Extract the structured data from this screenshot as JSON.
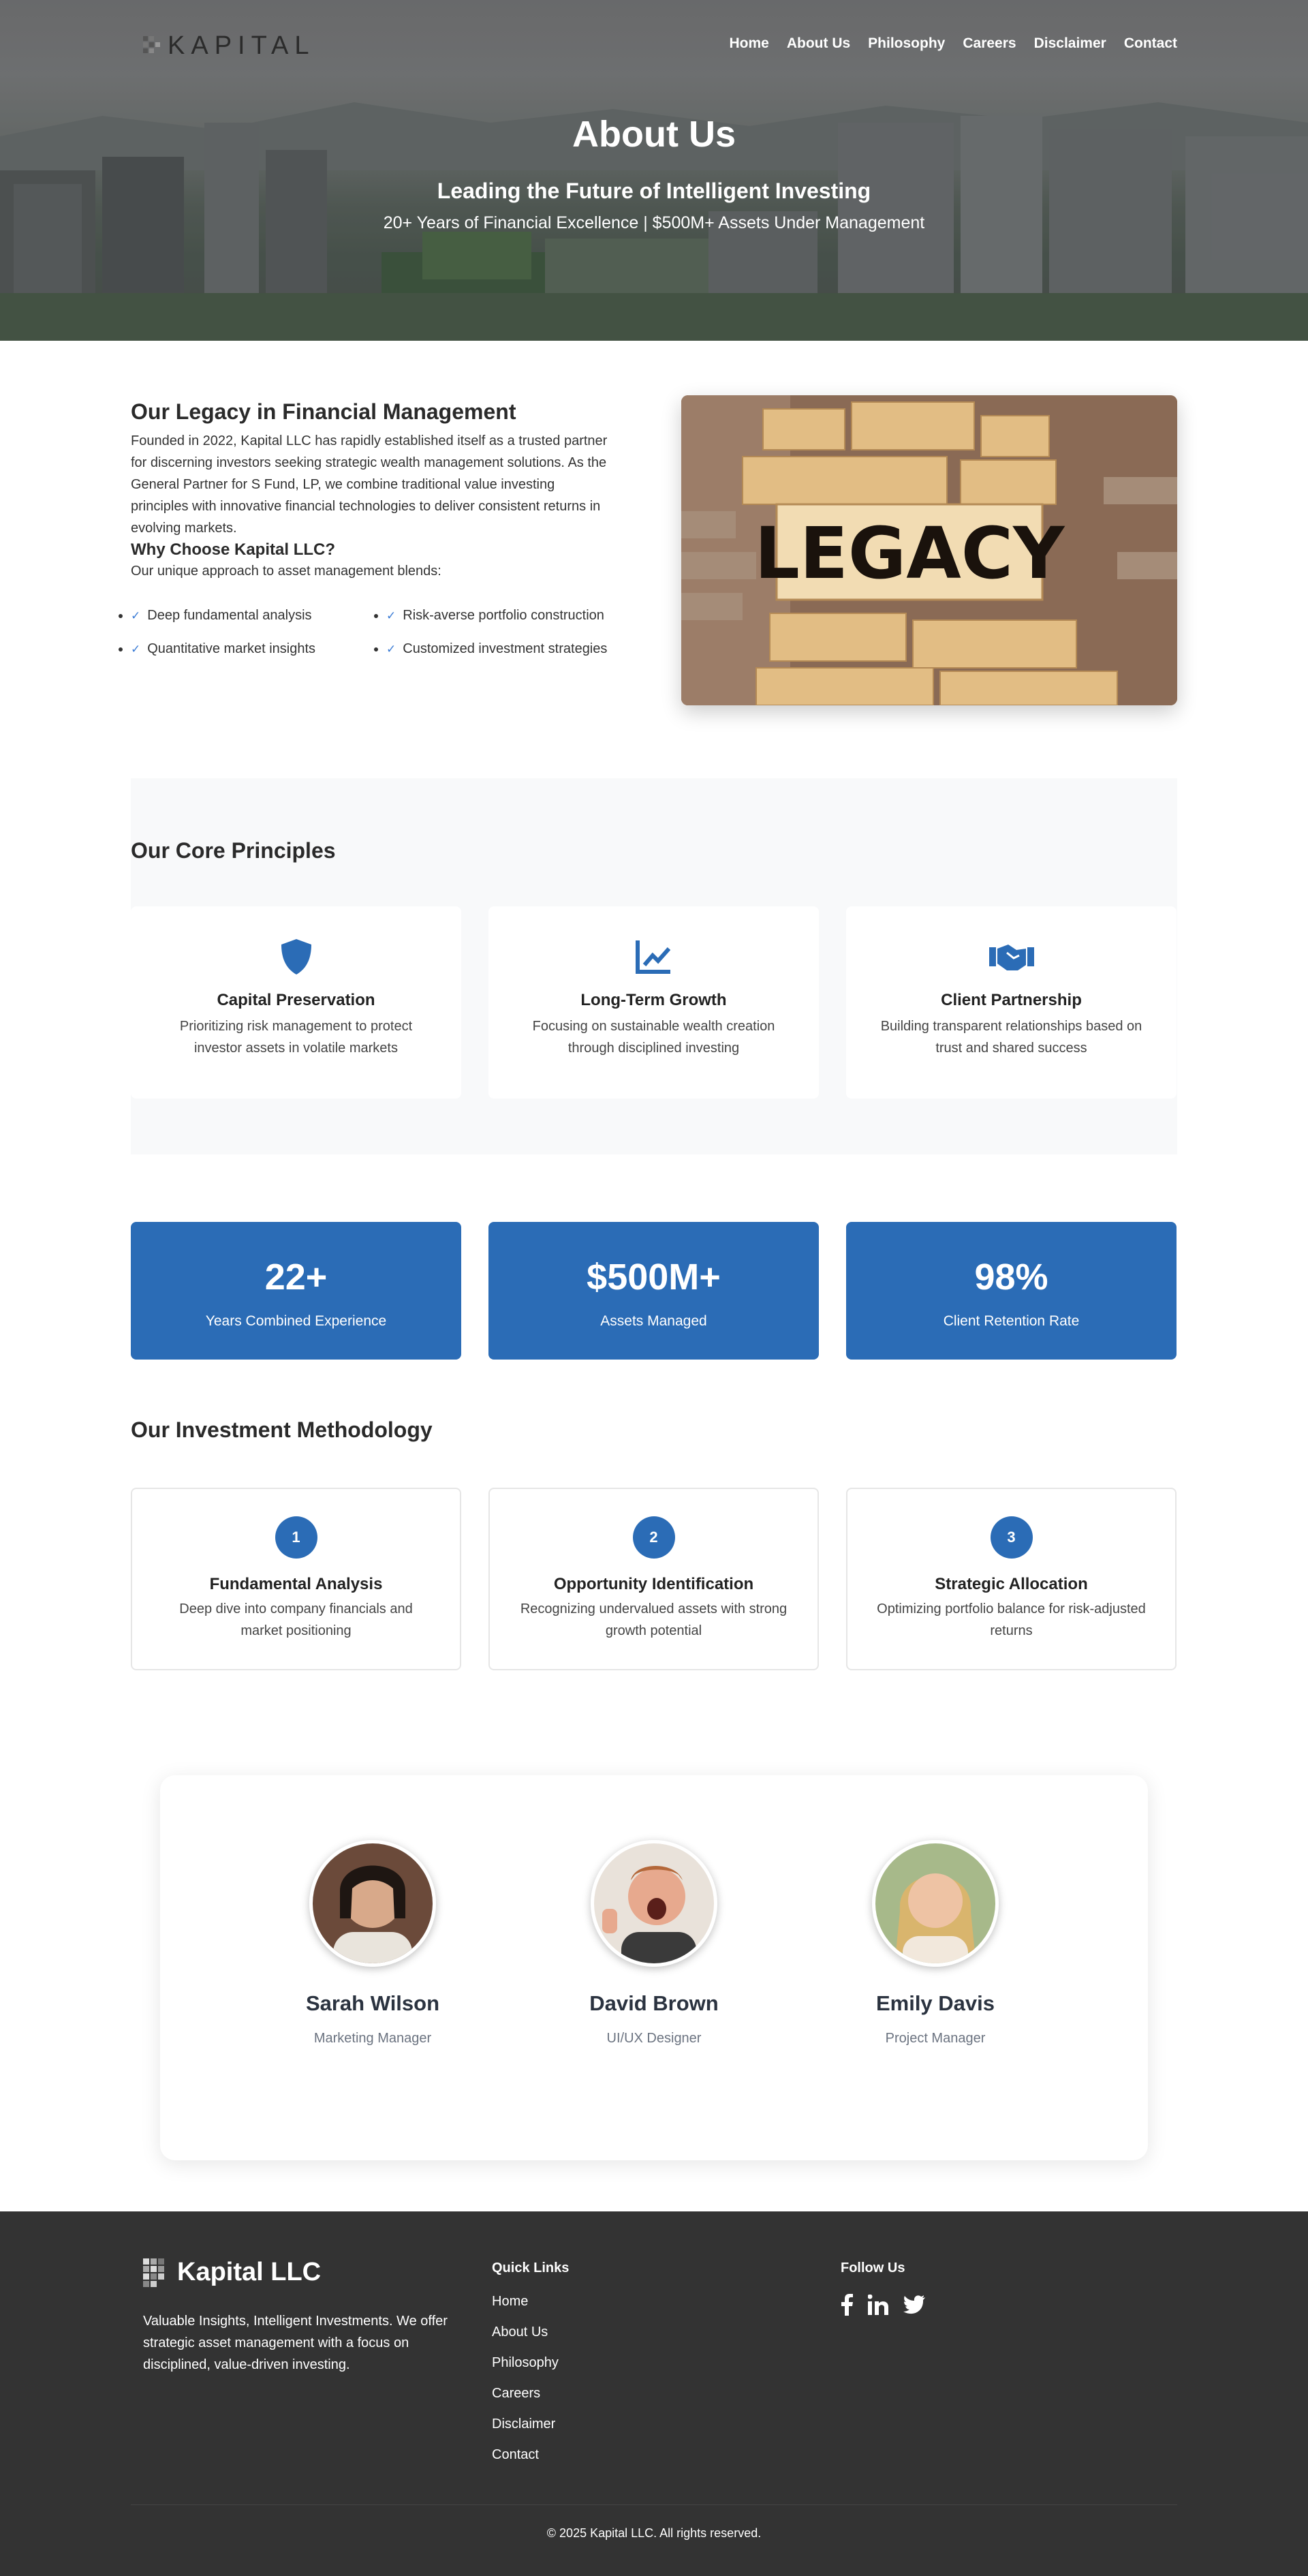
{
  "nav": {
    "logo_text": "KAPITAL",
    "items": [
      "Home",
      "About Us",
      "Philosophy",
      "Careers",
      "Disclaimer",
      "Contact"
    ]
  },
  "hero": {
    "title": "About Us",
    "subtitle": "Leading the Future of Intelligent Investing",
    "tagline": "20+ Years of Financial Excellence | $500M+ Assets Under Management"
  },
  "legacy": {
    "title": "Our Legacy in Financial Management",
    "paragraph": "Founded in 2022, Kapital LLC has rapidly established itself as a trusted partner for discerning investors seeking strategic wealth management solutions. As the General Partner for S Fund, LP, we combine traditional value investing principles with innovative financial technologies to deliver consistent returns in evolving markets.",
    "why_title": "Why Choose Kapital LLC?",
    "why_sub": "Our unique approach to asset management blends:",
    "bullets": [
      "Deep fundamental analysis",
      "Risk-averse portfolio construction",
      "Quantitative market insights",
      "Customized investment strategies"
    ],
    "image_word": "LEGACY"
  },
  "principles": {
    "title": "Our Core Principles",
    "cards": [
      {
        "icon": "shield-icon",
        "title": "Capital Preservation",
        "desc": "Prioritizing risk management to protect investor assets in volatile markets"
      },
      {
        "icon": "chart-line-icon",
        "title": "Long-Term Growth",
        "desc": "Focusing on sustainable wealth creation through disciplined investing"
      },
      {
        "icon": "handshake-icon",
        "title": "Client Partnership",
        "desc": "Building transparent relationships based on trust and shared success"
      }
    ]
  },
  "stats": [
    {
      "value": "22+",
      "label": "Years Combined Experience"
    },
    {
      "value": "$500M+",
      "label": "Assets Managed"
    },
    {
      "value": "98%",
      "label": "Client Retention Rate"
    }
  ],
  "methodology": {
    "title": "Our Investment Methodology",
    "steps": [
      {
        "num": "1",
        "title": "Fundamental Analysis",
        "desc": "Deep dive into company financials and market positioning"
      },
      {
        "num": "2",
        "title": "Opportunity Identification",
        "desc": "Recognizing undervalued assets with strong growth potential"
      },
      {
        "num": "3",
        "title": "Strategic Allocation",
        "desc": "Optimizing portfolio balance for risk-adjusted returns"
      }
    ]
  },
  "team": [
    {
      "name": "Sarah Wilson",
      "role": "Marketing Manager"
    },
    {
      "name": "David Brown",
      "role": "UI/UX Designer"
    },
    {
      "name": "Emily Davis",
      "role": "Project Manager"
    }
  ],
  "footer": {
    "logo_text": "Kapital LLC",
    "description": "Valuable Insights, Intelligent Investments. We offer strategic asset management with a focus on disciplined, value-driven investing.",
    "quick_links_title": "Quick Links",
    "quick_links": [
      "Home",
      "About Us",
      "Philosophy",
      "Careers",
      "Disclaimer",
      "Contact"
    ],
    "follow_title": "Follow Us",
    "socials": [
      "facebook-icon",
      "linkedin-icon",
      "twitter-icon"
    ],
    "copyright": "© 2025 Kapital LLC. All rights reserved."
  },
  "colors": {
    "accent": "#2b6cb6",
    "footer_bg": "#333333",
    "section_bg": "#f8f9fa"
  }
}
